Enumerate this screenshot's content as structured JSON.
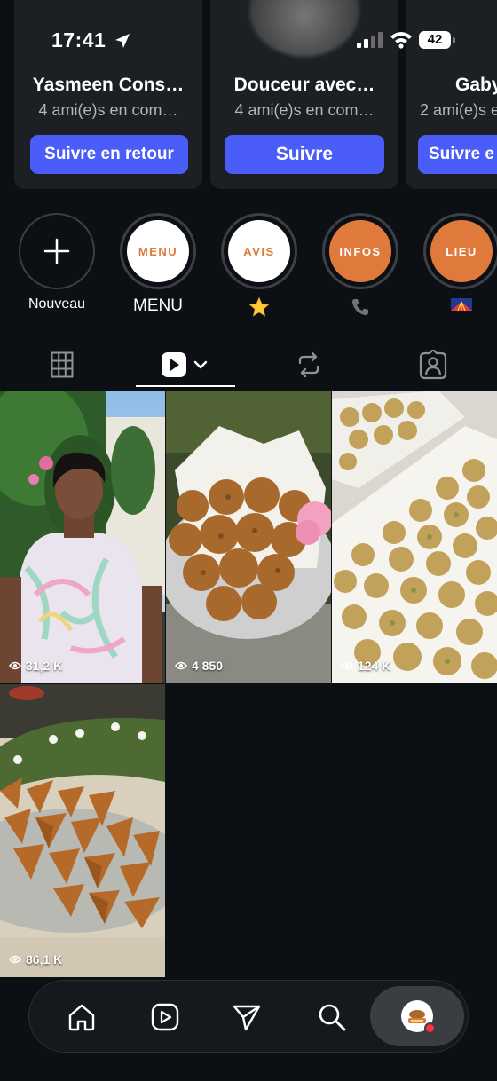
{
  "status_bar": {
    "time": "17:41",
    "battery": "42"
  },
  "suggestions": [
    {
      "name": "Yasmeen Cons…",
      "mutual": "4 ami(e)s en com…",
      "button": "Suivre en retour"
    },
    {
      "name": "Douceur avec…",
      "mutual": "4 ami(e)s en com…",
      "button": "Suivre"
    },
    {
      "name": "Gaby",
      "mutual": "2 ami(e)s en",
      "button": "Suivre e"
    }
  ],
  "highlights": {
    "new_label": "Nouveau",
    "items": [
      {
        "cover_text": "MENU",
        "label": "MENU"
      },
      {
        "cover_text": "AVIS",
        "label": "⭐"
      },
      {
        "cover_text": "INFOS",
        "label": "📞"
      },
      {
        "cover_text": "LIEU",
        "label": "flag"
      }
    ]
  },
  "tabs": [
    "grid",
    "reels",
    "reposts",
    "tagged"
  ],
  "posts": [
    {
      "views": "31,2 K",
      "subject": "woman-portrait"
    },
    {
      "views": "4 850",
      "subject": "fritters-plate"
    },
    {
      "views": "124 K",
      "subject": "fritters-tray"
    },
    {
      "views": "86,1 K",
      "subject": "samosas-platter"
    }
  ],
  "bottom_nav": [
    "home-icon",
    "reels-icon",
    "send-icon",
    "search-icon",
    "profile-avatar"
  ],
  "colors": {
    "background": "#0c1014",
    "button_blue": "#4a5df9",
    "highlight_orange": "#e07a3c",
    "card": "#1c1f24"
  }
}
